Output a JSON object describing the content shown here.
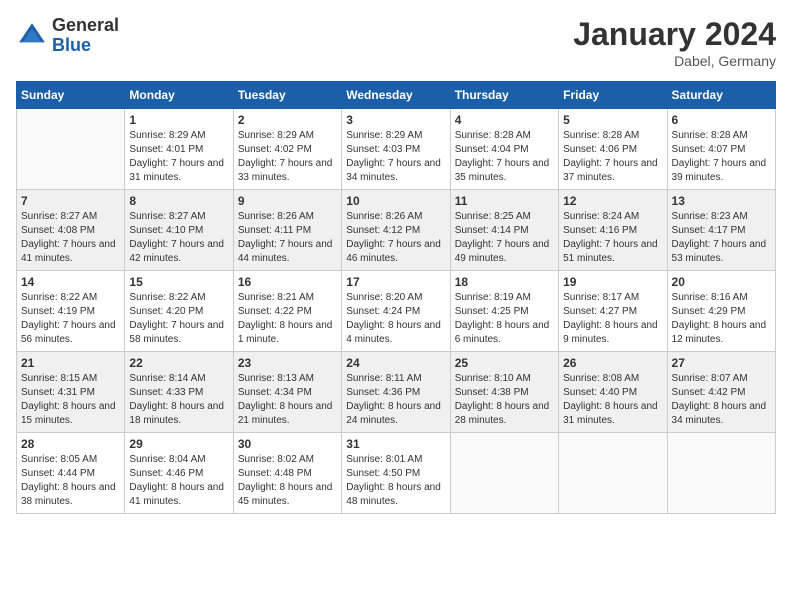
{
  "header": {
    "logo_line1": "General",
    "logo_line2": "Blue",
    "month_title": "January 2024",
    "location": "Dabel, Germany"
  },
  "days_of_week": [
    "Sunday",
    "Monday",
    "Tuesday",
    "Wednesday",
    "Thursday",
    "Friday",
    "Saturday"
  ],
  "weeks": [
    [
      {
        "day": "",
        "sunrise": "",
        "sunset": "",
        "daylight": ""
      },
      {
        "day": "1",
        "sunrise": "Sunrise: 8:29 AM",
        "sunset": "Sunset: 4:01 PM",
        "daylight": "Daylight: 7 hours and 31 minutes."
      },
      {
        "day": "2",
        "sunrise": "Sunrise: 8:29 AM",
        "sunset": "Sunset: 4:02 PM",
        "daylight": "Daylight: 7 hours and 33 minutes."
      },
      {
        "day": "3",
        "sunrise": "Sunrise: 8:29 AM",
        "sunset": "Sunset: 4:03 PM",
        "daylight": "Daylight: 7 hours and 34 minutes."
      },
      {
        "day": "4",
        "sunrise": "Sunrise: 8:28 AM",
        "sunset": "Sunset: 4:04 PM",
        "daylight": "Daylight: 7 hours and 35 minutes."
      },
      {
        "day": "5",
        "sunrise": "Sunrise: 8:28 AM",
        "sunset": "Sunset: 4:06 PM",
        "daylight": "Daylight: 7 hours and 37 minutes."
      },
      {
        "day": "6",
        "sunrise": "Sunrise: 8:28 AM",
        "sunset": "Sunset: 4:07 PM",
        "daylight": "Daylight: 7 hours and 39 minutes."
      }
    ],
    [
      {
        "day": "7",
        "sunrise": "Sunrise: 8:27 AM",
        "sunset": "Sunset: 4:08 PM",
        "daylight": "Daylight: 7 hours and 41 minutes."
      },
      {
        "day": "8",
        "sunrise": "Sunrise: 8:27 AM",
        "sunset": "Sunset: 4:10 PM",
        "daylight": "Daylight: 7 hours and 42 minutes."
      },
      {
        "day": "9",
        "sunrise": "Sunrise: 8:26 AM",
        "sunset": "Sunset: 4:11 PM",
        "daylight": "Daylight: 7 hours and 44 minutes."
      },
      {
        "day": "10",
        "sunrise": "Sunrise: 8:26 AM",
        "sunset": "Sunset: 4:12 PM",
        "daylight": "Daylight: 7 hours and 46 minutes."
      },
      {
        "day": "11",
        "sunrise": "Sunrise: 8:25 AM",
        "sunset": "Sunset: 4:14 PM",
        "daylight": "Daylight: 7 hours and 49 minutes."
      },
      {
        "day": "12",
        "sunrise": "Sunrise: 8:24 AM",
        "sunset": "Sunset: 4:16 PM",
        "daylight": "Daylight: 7 hours and 51 minutes."
      },
      {
        "day": "13",
        "sunrise": "Sunrise: 8:23 AM",
        "sunset": "Sunset: 4:17 PM",
        "daylight": "Daylight: 7 hours and 53 minutes."
      }
    ],
    [
      {
        "day": "14",
        "sunrise": "Sunrise: 8:22 AM",
        "sunset": "Sunset: 4:19 PM",
        "daylight": "Daylight: 7 hours and 56 minutes."
      },
      {
        "day": "15",
        "sunrise": "Sunrise: 8:22 AM",
        "sunset": "Sunset: 4:20 PM",
        "daylight": "Daylight: 7 hours and 58 minutes."
      },
      {
        "day": "16",
        "sunrise": "Sunrise: 8:21 AM",
        "sunset": "Sunset: 4:22 PM",
        "daylight": "Daylight: 8 hours and 1 minute."
      },
      {
        "day": "17",
        "sunrise": "Sunrise: 8:20 AM",
        "sunset": "Sunset: 4:24 PM",
        "daylight": "Daylight: 8 hours and 4 minutes."
      },
      {
        "day": "18",
        "sunrise": "Sunrise: 8:19 AM",
        "sunset": "Sunset: 4:25 PM",
        "daylight": "Daylight: 8 hours and 6 minutes."
      },
      {
        "day": "19",
        "sunrise": "Sunrise: 8:17 AM",
        "sunset": "Sunset: 4:27 PM",
        "daylight": "Daylight: 8 hours and 9 minutes."
      },
      {
        "day": "20",
        "sunrise": "Sunrise: 8:16 AM",
        "sunset": "Sunset: 4:29 PM",
        "daylight": "Daylight: 8 hours and 12 minutes."
      }
    ],
    [
      {
        "day": "21",
        "sunrise": "Sunrise: 8:15 AM",
        "sunset": "Sunset: 4:31 PM",
        "daylight": "Daylight: 8 hours and 15 minutes."
      },
      {
        "day": "22",
        "sunrise": "Sunrise: 8:14 AM",
        "sunset": "Sunset: 4:33 PM",
        "daylight": "Daylight: 8 hours and 18 minutes."
      },
      {
        "day": "23",
        "sunrise": "Sunrise: 8:13 AM",
        "sunset": "Sunset: 4:34 PM",
        "daylight": "Daylight: 8 hours and 21 minutes."
      },
      {
        "day": "24",
        "sunrise": "Sunrise: 8:11 AM",
        "sunset": "Sunset: 4:36 PM",
        "daylight": "Daylight: 8 hours and 24 minutes."
      },
      {
        "day": "25",
        "sunrise": "Sunrise: 8:10 AM",
        "sunset": "Sunset: 4:38 PM",
        "daylight": "Daylight: 8 hours and 28 minutes."
      },
      {
        "day": "26",
        "sunrise": "Sunrise: 8:08 AM",
        "sunset": "Sunset: 4:40 PM",
        "daylight": "Daylight: 8 hours and 31 minutes."
      },
      {
        "day": "27",
        "sunrise": "Sunrise: 8:07 AM",
        "sunset": "Sunset: 4:42 PM",
        "daylight": "Daylight: 8 hours and 34 minutes."
      }
    ],
    [
      {
        "day": "28",
        "sunrise": "Sunrise: 8:05 AM",
        "sunset": "Sunset: 4:44 PM",
        "daylight": "Daylight: 8 hours and 38 minutes."
      },
      {
        "day": "29",
        "sunrise": "Sunrise: 8:04 AM",
        "sunset": "Sunset: 4:46 PM",
        "daylight": "Daylight: 8 hours and 41 minutes."
      },
      {
        "day": "30",
        "sunrise": "Sunrise: 8:02 AM",
        "sunset": "Sunset: 4:48 PM",
        "daylight": "Daylight: 8 hours and 45 minutes."
      },
      {
        "day": "31",
        "sunrise": "Sunrise: 8:01 AM",
        "sunset": "Sunset: 4:50 PM",
        "daylight": "Daylight: 8 hours and 48 minutes."
      },
      {
        "day": "",
        "sunrise": "",
        "sunset": "",
        "daylight": ""
      },
      {
        "day": "",
        "sunrise": "",
        "sunset": "",
        "daylight": ""
      },
      {
        "day": "",
        "sunrise": "",
        "sunset": "",
        "daylight": ""
      }
    ]
  ]
}
